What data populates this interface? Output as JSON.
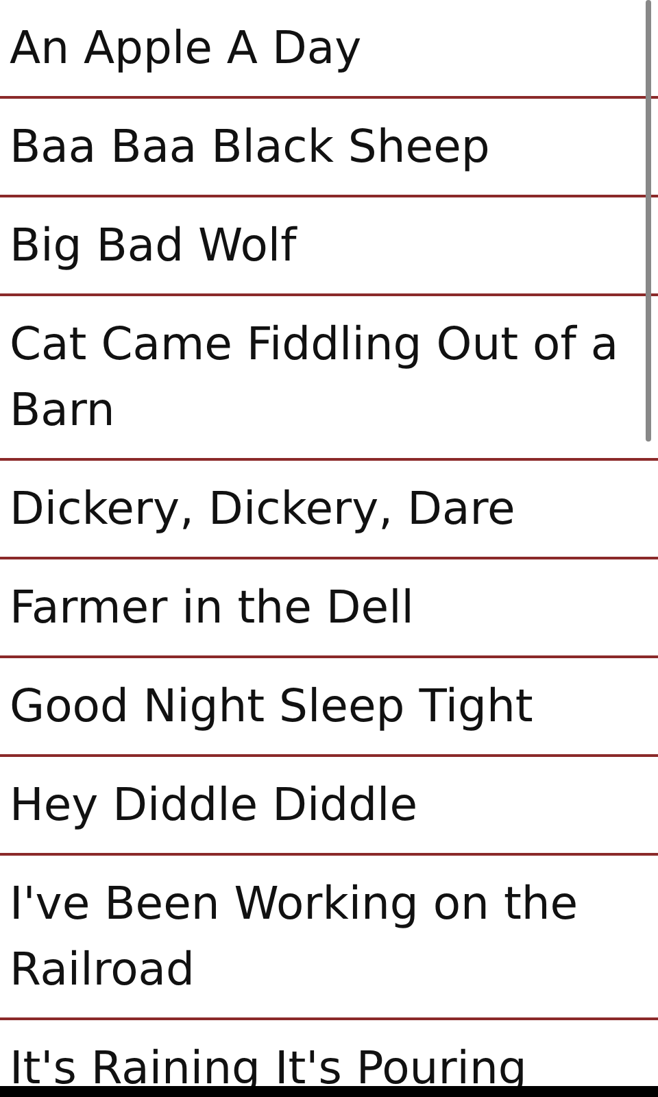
{
  "songs": [
    {
      "title": "An Apple A Day"
    },
    {
      "title": "Baa Baa Black Sheep"
    },
    {
      "title": "Big Bad Wolf"
    },
    {
      "title": "Cat Came Fiddling Out of a Barn"
    },
    {
      "title": "Dickery, Dickery, Dare"
    },
    {
      "title": "Farmer in the Dell"
    },
    {
      "title": "Good Night Sleep Tight"
    },
    {
      "title": "Hey Diddle Diddle"
    },
    {
      "title": "I've Been Working on the Railroad"
    },
    {
      "title": "It's Raining It's Pouring"
    }
  ]
}
